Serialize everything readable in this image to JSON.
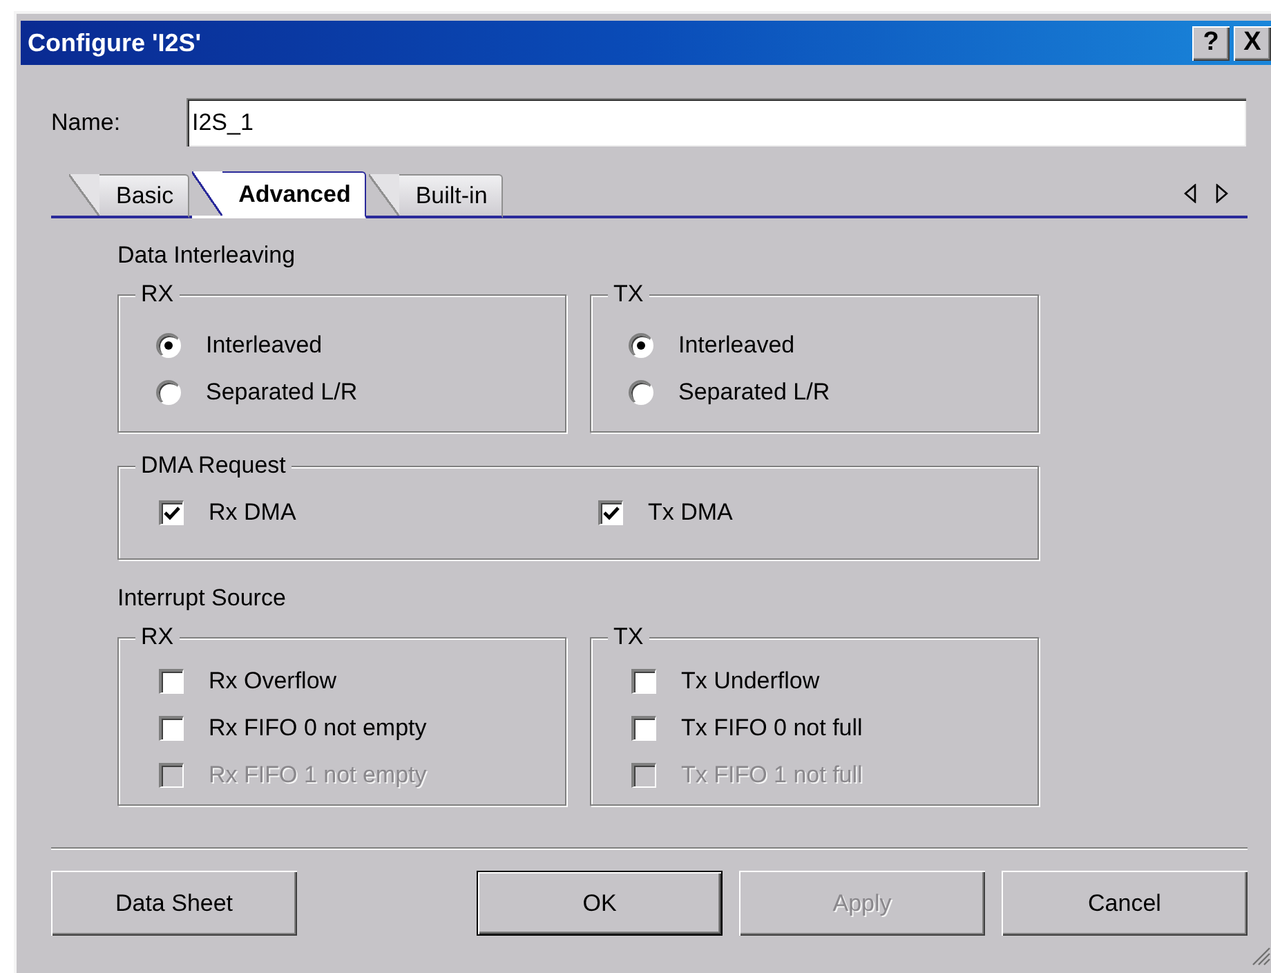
{
  "window": {
    "title": "Configure 'I2S'",
    "help_button": "?",
    "close_button": "X"
  },
  "name_field": {
    "label": "Name:",
    "value": "I2S_1"
  },
  "tabs": [
    {
      "label": "Basic",
      "selected": false
    },
    {
      "label": "Advanced",
      "selected": true
    },
    {
      "label": "Built-in",
      "selected": false
    }
  ],
  "data_interleaving": {
    "title": "Data Interleaving",
    "groups": [
      {
        "title": "RX",
        "options": [
          {
            "label": "Interleaved",
            "selected": true
          },
          {
            "label": "Separated L/R",
            "selected": false
          }
        ]
      },
      {
        "title": "TX",
        "options": [
          {
            "label": "Interleaved",
            "selected": true
          },
          {
            "label": "Separated L/R",
            "selected": false
          }
        ]
      }
    ]
  },
  "dma_request": {
    "title": "DMA Request",
    "options": [
      {
        "label": "Rx DMA",
        "checked": true
      },
      {
        "label": "Tx DMA",
        "checked": true
      }
    ]
  },
  "interrupt_source": {
    "title": "Interrupt Source",
    "groups": [
      {
        "title": "RX",
        "options": [
          {
            "label": "Rx Overflow",
            "checked": false,
            "disabled": false
          },
          {
            "label": "Rx FIFO 0 not empty",
            "checked": false,
            "disabled": false
          },
          {
            "label": "Rx FIFO 1 not empty",
            "checked": false,
            "disabled": true
          }
        ]
      },
      {
        "title": "TX",
        "options": [
          {
            "label": "Tx Underflow",
            "checked": false,
            "disabled": false
          },
          {
            "label": "Tx FIFO 0 not full",
            "checked": false,
            "disabled": false
          },
          {
            "label": "Tx FIFO 1 not full",
            "checked": false,
            "disabled": true
          }
        ]
      }
    ]
  },
  "buttons": [
    {
      "label": "Data Sheet",
      "default": false,
      "disabled": false
    },
    {
      "label": "OK",
      "default": true,
      "disabled": false
    },
    {
      "label": "Apply",
      "default": false,
      "disabled": true
    },
    {
      "label": "Cancel",
      "default": false,
      "disabled": false
    }
  ]
}
